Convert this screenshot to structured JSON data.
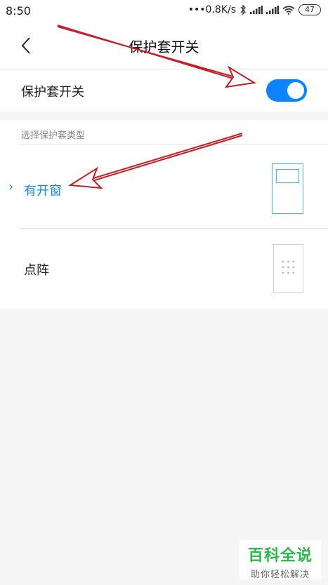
{
  "status_bar": {
    "time": "8:50",
    "network_speed": "•••0.8K/s",
    "battery": "47",
    "icons": [
      "bluetooth-icon",
      "signal-icon",
      "signal-icon",
      "wifi-icon",
      "battery-icon"
    ]
  },
  "nav": {
    "title": "保护套开关",
    "back_icon": "chevron-left-icon"
  },
  "switch_row": {
    "label": "保护套开关",
    "enabled": true,
    "accent_color": "#0d84ff"
  },
  "section": {
    "label": "选择保护套类型",
    "options": [
      {
        "label": "有开窗",
        "selected": true,
        "icon": "window-cover-icon",
        "color": "#1a8bd6"
      },
      {
        "label": "点阵",
        "selected": false,
        "icon": "dot-matrix-cover-icon",
        "color": "#222222"
      }
    ]
  },
  "watermark": {
    "title": "百科全说",
    "subtitle": "助你轻松解决"
  }
}
